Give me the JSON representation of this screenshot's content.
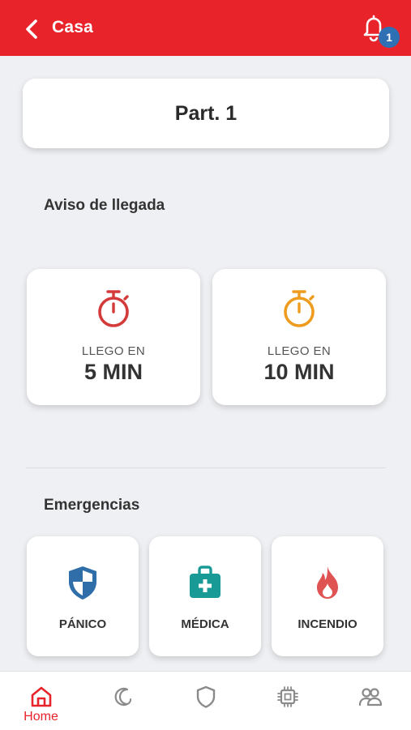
{
  "header": {
    "title": "Casa",
    "notification_count": "1",
    "background_color": "#e8232a",
    "back_icon": "chevron-left-icon",
    "notification_icon": "bell-icon"
  },
  "partition": {
    "name": "Part. 1"
  },
  "arrival": {
    "section_title": "Aviso de llegada",
    "cards": [
      {
        "line1": "LLEGO EN",
        "line2": "5 MIN",
        "icon": "stopwatch-icon",
        "color": "#d33a3a"
      },
      {
        "line1": "LLEGO EN",
        "line2": "10 MIN",
        "icon": "stopwatch-icon",
        "color": "#ef9b1e"
      }
    ]
  },
  "emergencies": {
    "section_title": "Emergencias",
    "cards": [
      {
        "label": "PÁNICO",
        "icon": "shield-icon",
        "color": "#2f6ea9"
      },
      {
        "label": "MÉDICA",
        "icon": "medical-kit-icon",
        "color": "#1a9a97"
      },
      {
        "label": "INCENDIO",
        "icon": "fire-icon",
        "color": "#e05353"
      }
    ]
  },
  "bottom_nav": {
    "active_color": "#e8232a",
    "inactive_color": "#8a8a8a",
    "items": [
      {
        "label": "Home",
        "icon": "home-icon",
        "active": true
      },
      {
        "label": "",
        "icon": "moon-icon",
        "active": false
      },
      {
        "label": "",
        "icon": "shield-outline-icon",
        "active": false
      },
      {
        "label": "",
        "icon": "chip-icon",
        "active": false
      },
      {
        "label": "",
        "icon": "users-icon",
        "active": false
      }
    ]
  }
}
